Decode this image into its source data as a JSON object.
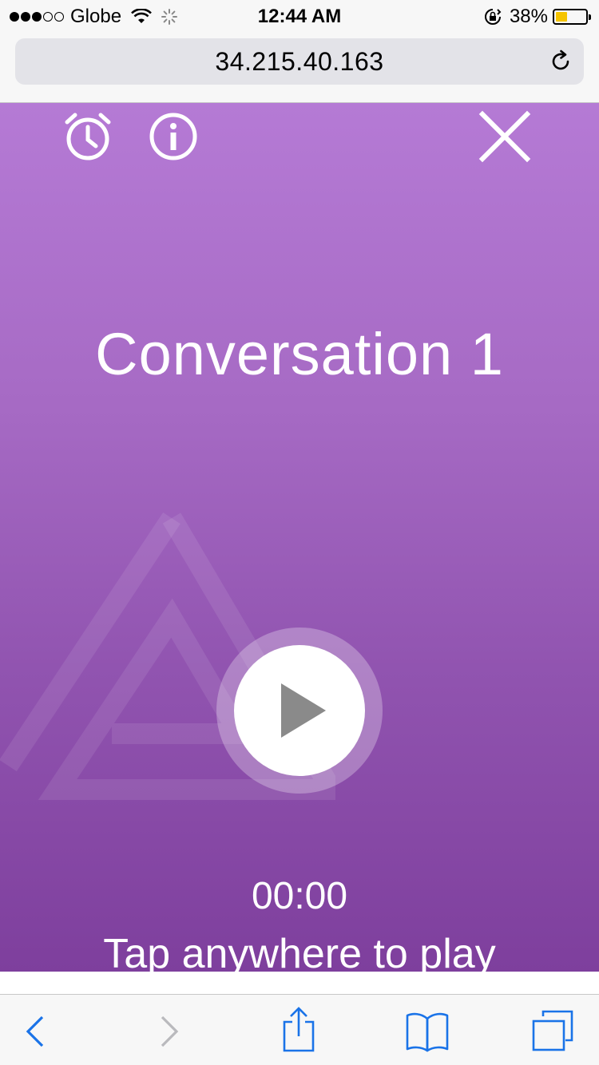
{
  "status_bar": {
    "signal_dots_filled": 3,
    "signal_dots_total": 5,
    "carrier": "Globe",
    "time": "12:44 AM",
    "battery_percent": "38%",
    "battery_level": 0.38,
    "battery_color": "#f5c400"
  },
  "browser": {
    "url": "34.215.40.163",
    "reload_icon": "reload-icon"
  },
  "player": {
    "title": "Conversation 1",
    "timer": "00:00",
    "hint": "Tap anywhere to play",
    "top_icons": [
      "alarm-clock-icon",
      "info-icon",
      "close-icon"
    ],
    "gradient_top": "#b57ad5",
    "gradient_bottom": "#7e3f9d"
  },
  "toolbar": {
    "icons": [
      "back-icon",
      "forward-icon",
      "share-icon",
      "bookmarks-icon",
      "tabs-icon"
    ],
    "accent": "#1a73e8"
  }
}
